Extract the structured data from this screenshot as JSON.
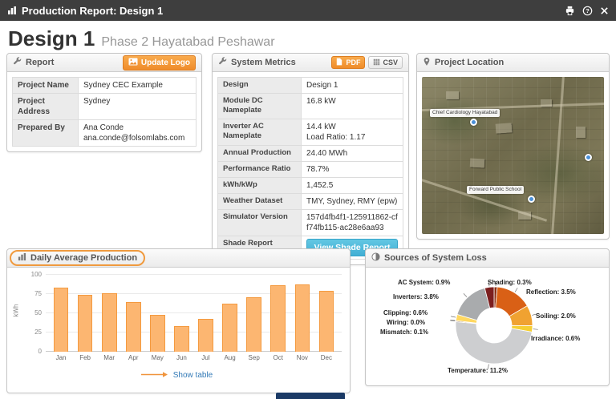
{
  "titlebar": {
    "title": "Production Report: Design 1"
  },
  "page": {
    "design_name": "Design 1",
    "design_subtitle": "Phase 2 Hayatabad Peshawar"
  },
  "icons": {
    "titlebar_left": "bar-chart-icon",
    "titlebar_right": [
      "print-icon",
      "help-icon",
      "close-icon"
    ],
    "report_header": "wrench-icon",
    "metrics_header": "wrench-icon",
    "location_header": "map-marker-icon",
    "production_header": "bar-chart-icon",
    "loss_header": "pie-chart-icon"
  },
  "report_panel": {
    "title": "Report",
    "update_logo_label": "Update Logo",
    "rows": [
      {
        "label": "Project Name",
        "value": "Sydney CEC Example"
      },
      {
        "label": "Project Address",
        "value": "Sydney"
      },
      {
        "label": "Prepared By",
        "value": "Ana Conde",
        "value2": "ana.conde@folsomlabs.com"
      }
    ]
  },
  "metrics_panel": {
    "title": "System Metrics",
    "pdf_label": "PDF",
    "csv_label": "CSV",
    "rows": [
      {
        "label": "Design",
        "value": "Design 1"
      },
      {
        "label": "Module DC Nameplate",
        "value": "16.8 kW"
      },
      {
        "label": "Inverter AC Nameplate",
        "value": "14.4 kW",
        "value2": "Load Ratio: 1.17"
      },
      {
        "label": "Annual Production",
        "value": "24.40 MWh"
      },
      {
        "label": "Performance Ratio",
        "value": "78.7%"
      },
      {
        "label": "kWh/kWp",
        "value": "1,452.5"
      },
      {
        "label": "Weather Dataset",
        "value": "TMY, Sydney, RMY (epw)"
      },
      {
        "label": "Simulator Version",
        "value": "157d4fb4f1-125911862-cff74fb115-ac28e6aa93"
      },
      {
        "label": "Shade Report",
        "button": "View Shade Report"
      }
    ]
  },
  "location_panel": {
    "title": "Project Location",
    "map_labels": [
      {
        "text": "Chief Cardiology Hayatabad"
      },
      {
        "text": "Forward Public School"
      }
    ]
  },
  "production_panel": {
    "title": "Daily Average Production",
    "show_table_label": "Show table"
  },
  "loss_panel": {
    "title": "Sources of System Loss"
  },
  "chart_data": [
    {
      "type": "bar",
      "title": "Daily Average Production",
      "categories": [
        "Jan",
        "Feb",
        "Mar",
        "Apr",
        "May",
        "Jun",
        "Jul",
        "Aug",
        "Sep",
        "Oct",
        "Nov",
        "Dec"
      ],
      "values": [
        83,
        74,
        76,
        65,
        48,
        33,
        43,
        62,
        71,
        86,
        88,
        79
      ],
      "xlabel": "",
      "ylabel": "kWh",
      "ylim": [
        0,
        100
      ],
      "yticks": [
        0,
        25,
        50,
        75,
        100
      ],
      "grid": true,
      "legend": false,
      "bar_color": "#fcb671",
      "bar_border": "#f49a3f"
    },
    {
      "type": "pie",
      "donut": true,
      "title": "Sources of System Loss",
      "items": [
        {
          "name": "Shading",
          "pct": 0.3,
          "text": "Shading: 0.3%",
          "color": "#8a2d12"
        },
        {
          "name": "Reflection",
          "pct": 3.5,
          "text": "Reflection: 3.5%",
          "color": "#d96016"
        },
        {
          "name": "Soiling",
          "pct": 2.0,
          "text": "Soiling: 2.0%",
          "color": "#f0a231"
        },
        {
          "name": "Irradiance",
          "pct": 0.6,
          "text": "Irradiance: 0.6%",
          "color": "#f5cf33"
        },
        {
          "name": "Temperature",
          "pct": 11.2,
          "text": "Temperature: 11.2%",
          "color": "#cdced0"
        },
        {
          "name": "Mismatch",
          "pct": 0.1,
          "text": "Mismatch: 0.1%",
          "color": "#8f5b2a"
        },
        {
          "name": "Wiring",
          "pct": 0.0,
          "text": "Wiring: 0.0%",
          "color": "#777777"
        },
        {
          "name": "Clipping",
          "pct": 0.6,
          "text": "Clipping: 0.6%",
          "color": "#ffd861"
        },
        {
          "name": "Inverters",
          "pct": 3.8,
          "text": "Inverters: 3.8%",
          "color": "#a9abad"
        },
        {
          "name": "AC System",
          "pct": 0.9,
          "text": "AC System: 0.9%",
          "color": "#7c1f1f"
        }
      ]
    }
  ],
  "colors": {
    "titlebar_bg": "#3e3e3e",
    "accent_orange": "#f0943c",
    "button_orange": "#ef8c2a",
    "info_blue": "#42afd4",
    "link_blue": "#337ab7"
  }
}
